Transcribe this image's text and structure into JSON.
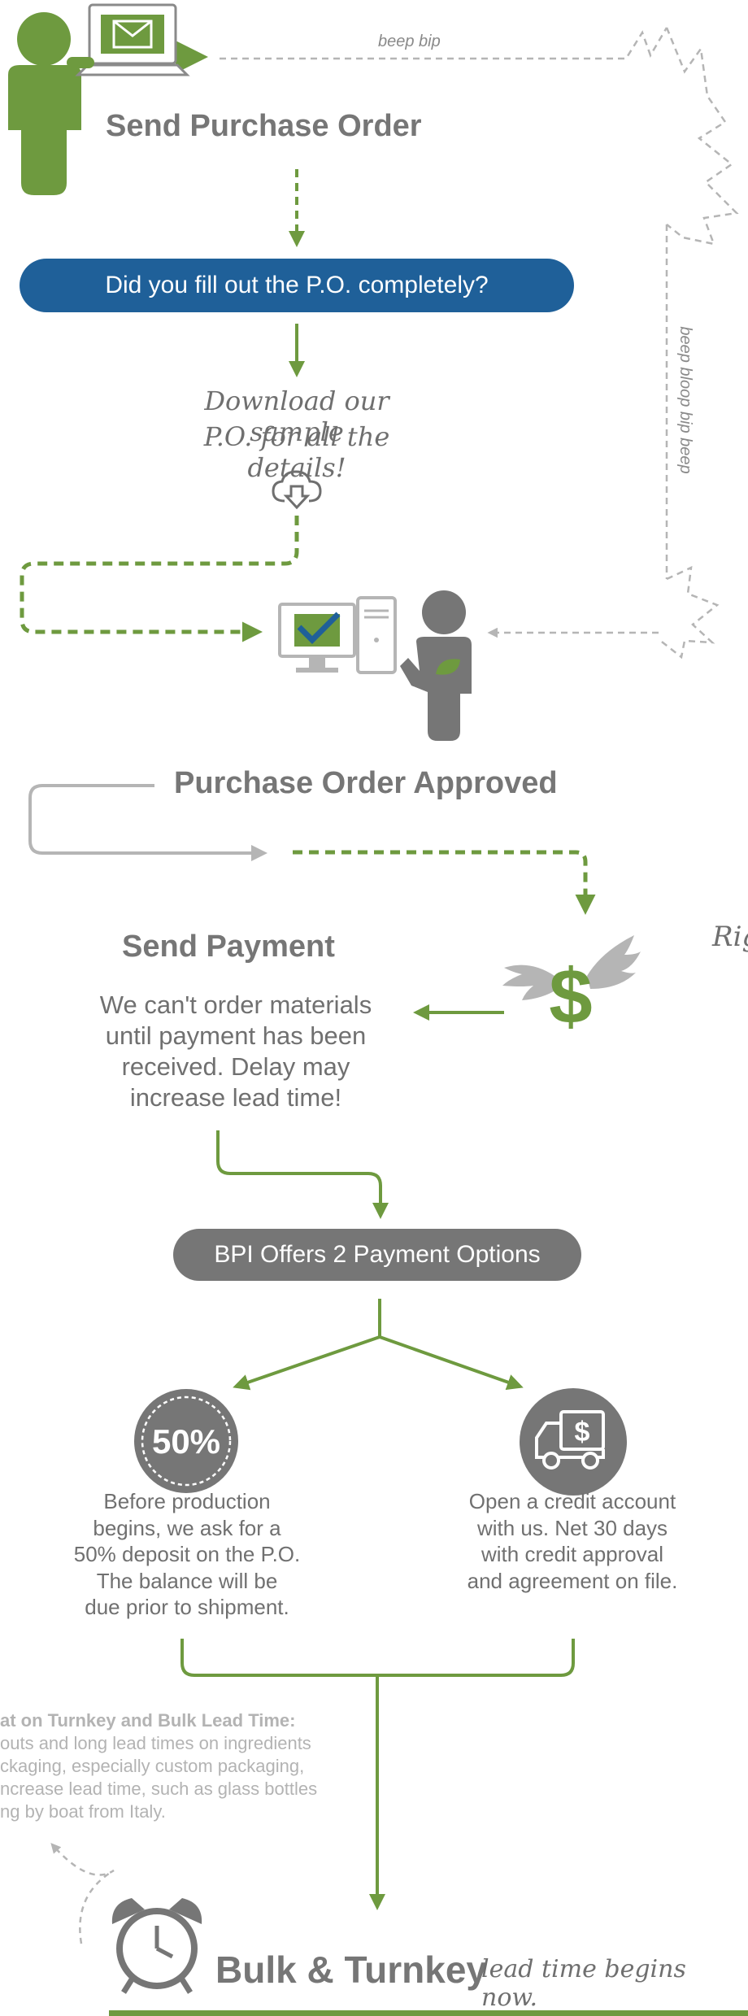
{
  "flow": {
    "send_po": {
      "title": "Send Purchase Order",
      "signal_label": "beep bip"
    },
    "check": {
      "question": "Did you fill out the P.O. completely?"
    },
    "download": {
      "line1": "Download our sample",
      "line2": "P.O. for all the details!"
    },
    "return_signal": {
      "label": "beep bloop bip beep"
    },
    "approved": {
      "title": "Purchase Order Approved"
    },
    "payment": {
      "title": "Send Payment",
      "note_lines": [
        "We can't order materials",
        "until payment has been",
        "received. Delay may",
        "increase lead time!"
      ],
      "dollar_symbol": "$"
    },
    "right_cut_text": "Rig",
    "options": {
      "header": "BPI Offers 2 Payment Options",
      "deposit": {
        "badge": "50%",
        "lines": [
          "Before production",
          "begins, we ask for a",
          "50% deposit on the P.O.",
          "The balance will be",
          "due prior to shipment."
        ]
      },
      "credit": {
        "truck_symbol": "$",
        "lines": [
          "Open a credit account",
          "with us. Net 30 days",
          "with credit approval",
          "and agreement on file."
        ]
      }
    },
    "lead_time_note": {
      "title": "at on Turnkey and Bulk Lead Time:",
      "lines": [
        "outs and long lead times on ingredients",
        "ckaging, especially custom packaging,",
        "ncrease lead time, such as glass bottles",
        "ng by boat from Italy."
      ]
    },
    "final": {
      "title": "Bulk & Turnkey",
      "tagline": "lead time begins now."
    }
  },
  "colors": {
    "green": "#6e9a3f",
    "blue": "#1f6099",
    "gray": "#777777",
    "light_gray": "#b5b5b5"
  }
}
